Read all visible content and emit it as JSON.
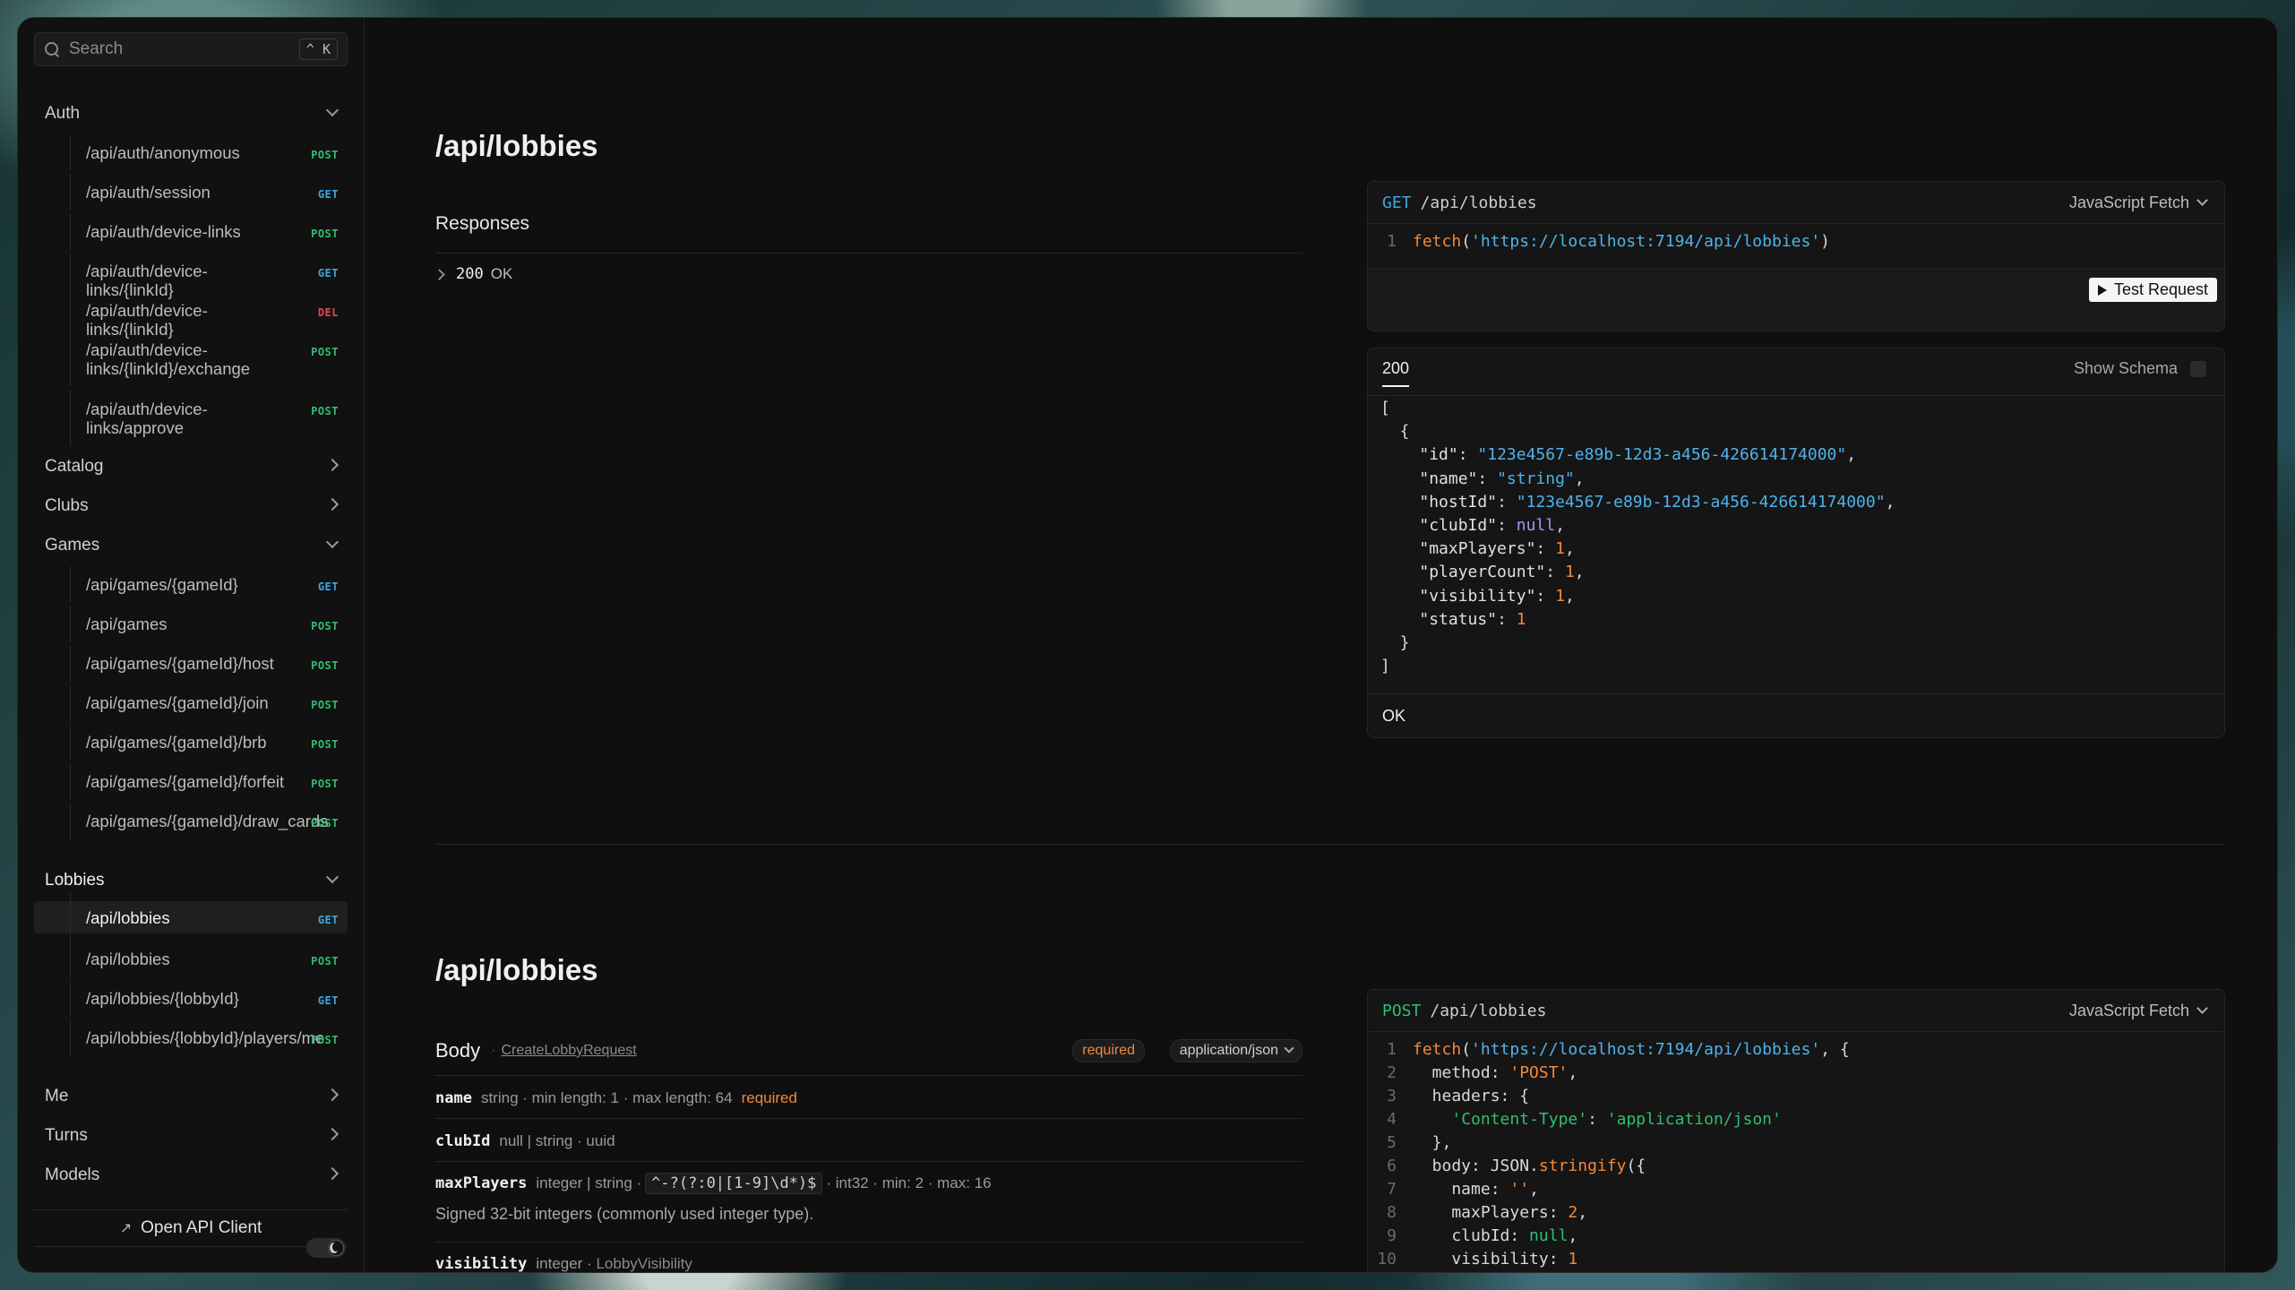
{
  "sidebar": {
    "search": {
      "placeholder": "Search",
      "shortcut": "^ K"
    },
    "groups": {
      "auth": "Auth",
      "catalog": "Catalog",
      "clubs": "Clubs",
      "games": "Games",
      "lobbies": "Lobbies",
      "me": "Me",
      "turns": "Turns",
      "models": "Models"
    },
    "auth_items": [
      {
        "path": "/api/auth/anonymous",
        "method": "POST"
      },
      {
        "path": "/api/auth/session",
        "method": "GET"
      },
      {
        "path": "/api/auth/device-links",
        "method": "POST"
      },
      {
        "path": "/api/auth/device-links/{linkId}",
        "method": "GET"
      },
      {
        "path": "/api/auth/device-links/{linkId}",
        "method": "DEL"
      },
      {
        "path": "/api/auth/device-links/{linkId}/exchange",
        "method": "POST"
      },
      {
        "path": "/api/auth/device-links/approve",
        "method": "POST"
      }
    ],
    "games_items": [
      {
        "path": "/api/games/{gameId}",
        "method": "GET"
      },
      {
        "path": "/api/games",
        "method": "POST"
      },
      {
        "path": "/api/games/{gameId}/host",
        "method": "POST"
      },
      {
        "path": "/api/games/{gameId}/join",
        "method": "POST"
      },
      {
        "path": "/api/games/{gameId}/brb",
        "method": "POST"
      },
      {
        "path": "/api/games/{gameId}/forfeit",
        "method": "POST"
      },
      {
        "path": "/api/games/{gameId}/draw_cards",
        "method": "POST"
      }
    ],
    "lobbies_items": [
      {
        "path": "/api/lobbies",
        "method": "GET"
      },
      {
        "path": "/api/lobbies",
        "method": "POST"
      },
      {
        "path": "/api/lobbies/{lobbyId}",
        "method": "GET"
      },
      {
        "path": "/api/lobbies/{lobbyId}/players/me",
        "method": "POST"
      }
    ],
    "open_client": "Open API Client"
  },
  "section1": {
    "title": "/api/lobbies",
    "responses_label": "Responses",
    "response_code": "200",
    "response_text": "OK",
    "request_card": {
      "verb": "GET",
      "path": "/api/lobbies",
      "language": "JavaScript Fetch",
      "line_no": "1",
      "fn": "fetch",
      "url": "'https://localhost:7194/api/lobbies'",
      "test_label": "Test Request"
    },
    "response_card": {
      "tab": "200",
      "show_schema": "Show Schema",
      "footer": "OK",
      "json": {
        "id": "\"123e4567-e89b-12d3-a456-426614174000\"",
        "name": "\"string\"",
        "hostId": "\"123e4567-e89b-12d3-a456-426614174000\"",
        "clubId": "null",
        "maxPlayers": "1",
        "playerCount": "1",
        "visibility": "1",
        "status": "1"
      }
    }
  },
  "section2": {
    "title": "/api/lobbies",
    "body_label": "Body",
    "body_ref": "CreateLobbyRequest",
    "required_pill": "required",
    "content_type": "application/json",
    "fields": {
      "name": {
        "name": "name",
        "meta": "string · min length:  1 · max length:  64",
        "req": "required"
      },
      "clubId": {
        "name": "clubId",
        "meta": "null | string · uuid"
      },
      "maxPlayers": {
        "name": "maxPlayers",
        "meta_a": "integer | string ·",
        "pattern": "^-?(?:0|[1-9]\\d*)$",
        "meta_b": "· int32 · min:  2 · max:  16",
        "desc": "Signed 32-bit integers (commonly used integer type)."
      },
      "visibility": {
        "name": "visibility",
        "meta": "integer ·",
        "ref": "LobbyVisibility"
      }
    },
    "request_card": {
      "verb": "POST",
      "path": "/api/lobbies",
      "language": "JavaScript Fetch",
      "url": "'https://localhost:7194/api/lobbies'",
      "method_val": "'POST'",
      "ct_key": "'Content-Type'",
      "ct_val": "'application/json'",
      "name_val": "''",
      "maxPlayers_val": "2",
      "clubId_val": "null",
      "visibility_val": "1"
    }
  },
  "colors": {
    "post": "#2fbf71",
    "get": "#3fa7e0",
    "delete": "#e5484d",
    "accent_orange": "#f0883e",
    "string_blue": "#4fb3ea"
  }
}
